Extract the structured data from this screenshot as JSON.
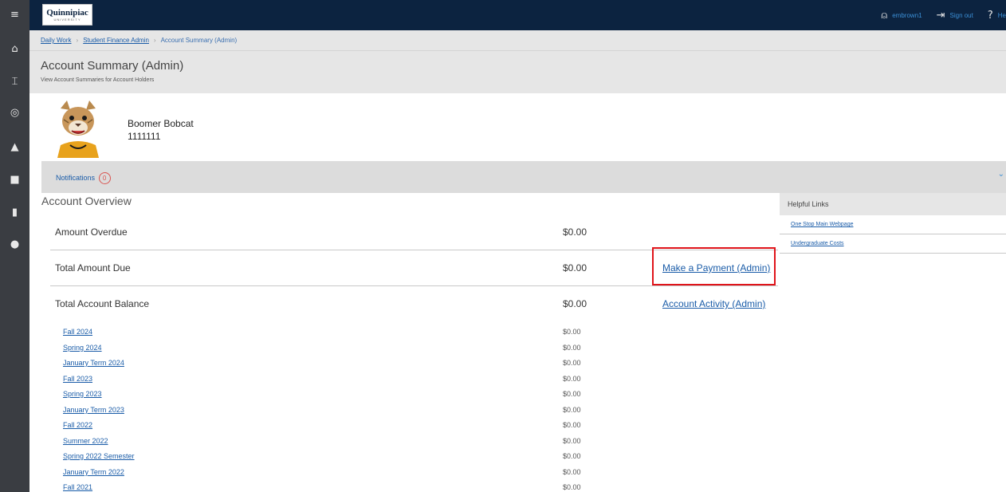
{
  "rail": {
    "items": [
      {
        "icon": "menu-icon",
        "glyph": "≡"
      },
      {
        "icon": "home-icon",
        "glyph": "⌂"
      },
      {
        "icon": "bank-icon",
        "glyph": "⌶"
      },
      {
        "icon": "id-card-icon",
        "glyph": "◎"
      },
      {
        "icon": "graduation-cap-icon",
        "glyph": "▲"
      },
      {
        "icon": "briefcase-icon",
        "glyph": "■"
      },
      {
        "icon": "book-icon",
        "glyph": "▮"
      },
      {
        "icon": "user-circle-icon",
        "glyph": "●"
      }
    ]
  },
  "header": {
    "logo_main": "Quinnipiac",
    "logo_sub": "UNIVERSITY",
    "user": "embrown1",
    "sign_out": "Sign out",
    "help": "He"
  },
  "breadcrumb": {
    "items": [
      "Daily Work",
      "Student Finance Admin"
    ],
    "current": "Account Summary (Admin)"
  },
  "page": {
    "title": "Account Summary (Admin)",
    "subtitle": "View Account Summaries for Account Holders"
  },
  "profile": {
    "name": "Boomer Bobcat",
    "id": "1111111"
  },
  "notifications": {
    "label": "Notifications",
    "count": "0"
  },
  "overview": {
    "title": "Account Overview",
    "rows": [
      {
        "label": "Amount Overdue",
        "value": "$0.00",
        "link": ""
      },
      {
        "label": "Total Amount Due",
        "value": "$0.00",
        "link": "Make a Payment (Admin)"
      },
      {
        "label": "Total Account Balance",
        "value": "$0.00",
        "link": "Account Activity (Admin)"
      }
    ],
    "terms": [
      {
        "name": "Fall 2024",
        "amount": "$0.00"
      },
      {
        "name": "Spring 2024",
        "amount": "$0.00"
      },
      {
        "name": "January Term 2024",
        "amount": "$0.00"
      },
      {
        "name": "Fall 2023",
        "amount": "$0.00"
      },
      {
        "name": "Spring 2023",
        "amount": "$0.00"
      },
      {
        "name": "January Term 2023",
        "amount": "$0.00"
      },
      {
        "name": "Fall 2022",
        "amount": "$0.00"
      },
      {
        "name": "Summer 2022",
        "amount": "$0.00"
      },
      {
        "name": "Spring 2022 Semester",
        "amount": "$0.00"
      },
      {
        "name": "January Term 2022",
        "amount": "$0.00"
      },
      {
        "name": "Fall 2021",
        "amount": "$0.00"
      }
    ]
  },
  "helpful_links": {
    "title": "Helpful Links",
    "links": [
      "One Stop Main Webpage",
      "Undergraduate Costs"
    ]
  },
  "colors": {
    "topbar": "#0c2340",
    "rail": "#3a3d42",
    "link": "#1a5ca8",
    "highlight": "#e0141a"
  }
}
